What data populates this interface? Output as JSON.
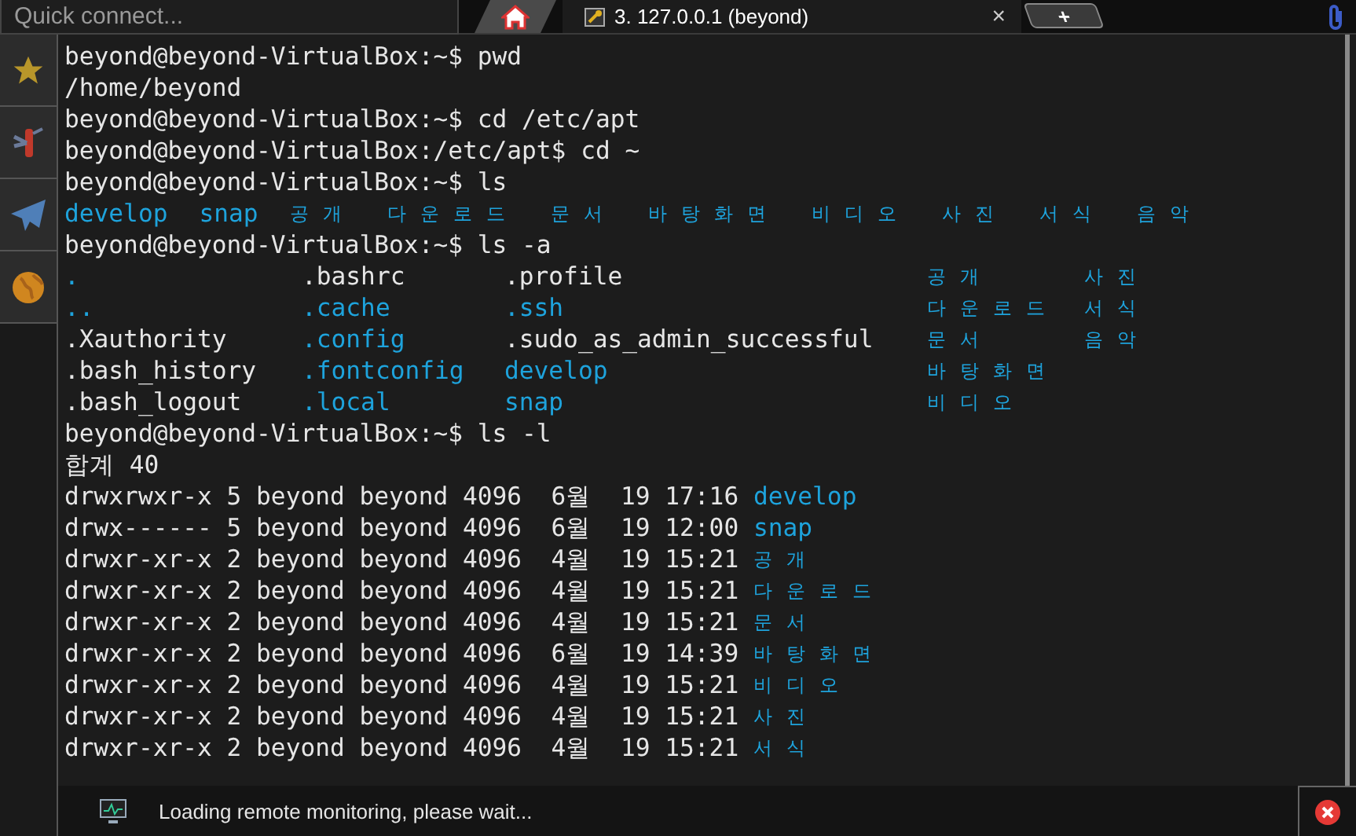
{
  "toolbar": {
    "quick_connect": {
      "placeholder": "Quick connect..."
    },
    "tabs": [
      {
        "kind": "home",
        "selected": false
      },
      {
        "kind": "session",
        "title": "3. 127.0.0.1 (beyond)",
        "close": "×",
        "selected": true
      },
      {
        "kind": "new",
        "label": "+",
        "selected": false
      }
    ]
  },
  "sidebar": {
    "items": [
      {
        "kind": "star"
      },
      {
        "kind": "tools"
      },
      {
        "kind": "plane"
      },
      {
        "kind": "globe"
      }
    ]
  },
  "terminal": {
    "lines": [
      {
        "kind": "command",
        "prompt": "beyond@beyond-VirtualBox:~$",
        "command": "pwd"
      },
      {
        "kind": "output",
        "text": "/home/beyond"
      },
      {
        "kind": "command",
        "prompt": "beyond@beyond-VirtualBox:~$",
        "command": "cd /etc/apt"
      },
      {
        "kind": "command",
        "prompt": "beyond@beyond-VirtualBox:/etc/apt$",
        "command": "cd ~"
      },
      {
        "kind": "command",
        "prompt": "beyond@beyond-VirtualBox:~$",
        "command": "ls"
      },
      {
        "kind": "names",
        "items": [
          {
            "text": "develop",
            "dir": true
          },
          {
            "text": "snap",
            "dir": true
          },
          {
            "text": "공개",
            "dir": true
          },
          {
            "text": "다운로드",
            "dir": true
          },
          {
            "text": "문서",
            "dir": true
          },
          {
            "text": "바탕화면",
            "dir": true
          },
          {
            "text": "비디오",
            "dir": true
          },
          {
            "text": "사진",
            "dir": true
          },
          {
            "text": "서식",
            "dir": true
          },
          {
            "text": "음악",
            "dir": true
          }
        ]
      },
      {
        "kind": "command",
        "prompt": "beyond@beyond-VirtualBox:~$",
        "command": "ls -a"
      },
      {
        "kind": "grid",
        "rows": [
          [
            {
              "text": ".",
              "dir": true
            },
            {
              "text": ".bashrc",
              "dir": false
            },
            {
              "text": ".profile",
              "dir": false
            },
            {
              "text": "공개",
              "dir": true
            },
            {
              "text": "사진",
              "dir": true
            }
          ],
          [
            {
              "text": "..",
              "dir": true
            },
            {
              "text": ".cache",
              "dir": true
            },
            {
              "text": ".ssh",
              "dir": true
            },
            {
              "text": "다운로드",
              "dir": true
            },
            {
              "text": "서식",
              "dir": true
            }
          ],
          [
            {
              "text": ".Xauthority",
              "dir": false
            },
            {
              "text": ".config",
              "dir": true
            },
            {
              "text": ".sudo_as_admin_successful",
              "dir": false
            },
            {
              "text": "문서",
              "dir": true
            },
            {
              "text": "음악",
              "dir": true
            }
          ],
          [
            {
              "text": ".bash_history",
              "dir": false
            },
            {
              "text": ".fontconfig",
              "dir": true
            },
            {
              "text": "develop",
              "dir": true
            },
            {
              "text": "바탕화면",
              "dir": true
            }
          ],
          [
            {
              "text": ".bash_logout",
              "dir": false
            },
            {
              "text": ".local",
              "dir": true
            },
            {
              "text": "snap",
              "dir": true
            },
            {
              "text": "비디오",
              "dir": true
            }
          ]
        ]
      },
      {
        "kind": "command",
        "prompt": "beyond@beyond-VirtualBox:~$",
        "command": "ls -l"
      },
      {
        "kind": "output",
        "text": "합계 40"
      },
      {
        "kind": "long",
        "info": "drwxrwxr-x 5 beyond beyond 4096  6월  19 17:16",
        "name": {
          "text": "develop",
          "dir": true
        }
      },
      {
        "kind": "long",
        "info": "drwx------ 5 beyond beyond 4096  6월  19 12:00",
        "name": {
          "text": "snap",
          "dir": true
        }
      },
      {
        "kind": "long",
        "info": "drwxr-xr-x 2 beyond beyond 4096  4월  19 15:21",
        "name": {
          "text": "공개",
          "dir": true
        }
      },
      {
        "kind": "long",
        "info": "drwxr-xr-x 2 beyond beyond 4096  4월  19 15:21",
        "name": {
          "text": "다운로드",
          "dir": true
        }
      },
      {
        "kind": "long",
        "info": "drwxr-xr-x 2 beyond beyond 4096  4월  19 15:21",
        "name": {
          "text": "문서",
          "dir": true
        }
      },
      {
        "kind": "long",
        "info": "drwxr-xr-x 2 beyond beyond 4096  6월  19 14:39",
        "name": {
          "text": "바탕화면",
          "dir": true
        }
      },
      {
        "kind": "long",
        "info": "drwxr-xr-x 2 beyond beyond 4096  4월  19 15:21",
        "name": {
          "text": "비디오",
          "dir": true
        }
      },
      {
        "kind": "long",
        "info": "drwxr-xr-x 2 beyond beyond 4096  4월  19 15:21",
        "name": {
          "text": "사진",
          "dir": true
        }
      },
      {
        "kind": "long",
        "info": "drwxr-xr-x 2 beyond beyond 4096  4월  19 15:21",
        "name": {
          "text": "서식",
          "dir": true
        }
      }
    ]
  },
  "status_bar": {
    "message": "Loading remote monitoring, please wait..."
  }
}
